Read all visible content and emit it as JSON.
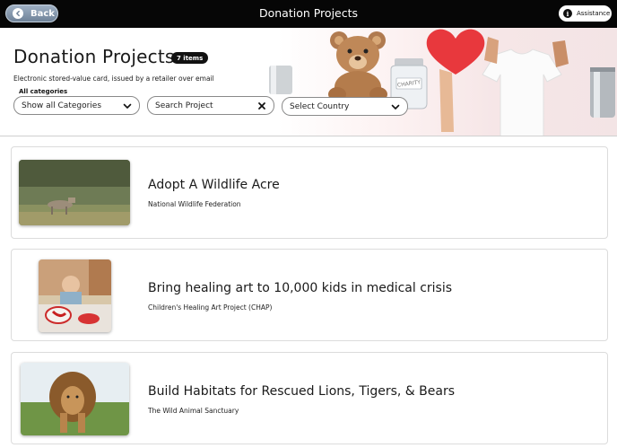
{
  "topbar": {
    "back_label": "Back",
    "title": "Donation Projects",
    "assistance_label": "Assistance"
  },
  "header": {
    "title": "Donation Projects",
    "count_badge": "7 items",
    "subtitle": "Electronic stored-value card, issued by a retailer over email",
    "category_label": "All categories",
    "category_value": "Show all Categories",
    "search_placeholder": "Search Project",
    "country_placeholder": "Select Country",
    "jar_label": "CHARITY"
  },
  "projects": [
    {
      "title": "Adopt A Wildlife Acre",
      "org": "National Wildlife Federation",
      "image": "wolf-on-grassland"
    },
    {
      "title": "Bring healing art to 10,000 kids in medical crisis",
      "org": "Children's Healing Art Project (CHAP)",
      "image": "child-painting"
    },
    {
      "title": "Build Habitats for Rescued Lions, Tigers, & Bears",
      "org": "The Wild Animal Sanctuary",
      "image": "lion-walking"
    }
  ],
  "colors": {
    "topbar_bg": "#060606",
    "accent_heart": "#e8383d",
    "badge_bg": "#111111"
  }
}
